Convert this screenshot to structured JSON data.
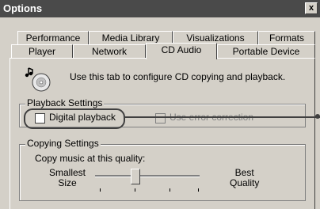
{
  "window": {
    "title": "Options",
    "close_label": "x"
  },
  "tabs_row1": [
    "Performance",
    "Media Library",
    "Visualizations",
    "Formats"
  ],
  "tabs_row2": [
    "Player",
    "Network",
    "CD Audio",
    "Portable Device"
  ],
  "active_tab": "CD Audio",
  "intro_text": "Use this tab to configure CD copying and playback.",
  "playback_settings": {
    "legend": "Playback Settings",
    "digital_playback": {
      "label": "Digital playback",
      "checked": false
    },
    "error_correction": {
      "label": "Use error correction",
      "checked": false,
      "enabled": false
    }
  },
  "copying_settings": {
    "legend": "Copying Settings",
    "quality_label": "Copy music at this quality:",
    "smallest_size_label": [
      "Smallest",
      "Size"
    ],
    "best_quality_label": [
      "Best",
      "Quality"
    ],
    "quality_level_fraction": 0.35
  },
  "icons": {
    "cd_icon": "cd-music-icon"
  }
}
